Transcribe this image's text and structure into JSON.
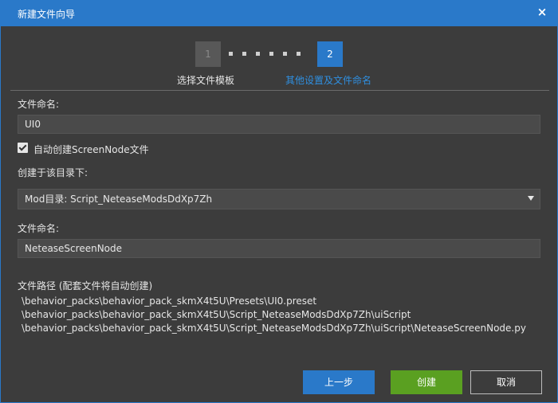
{
  "window": {
    "title": "新建文件向导",
    "close_icon": "×"
  },
  "steps": [
    {
      "number": "1",
      "label": "选择文件模板",
      "state": "done"
    },
    {
      "number": "2",
      "label": "其他设置及文件命名",
      "state": "active"
    }
  ],
  "form": {
    "filename_label": "文件命名:",
    "filename_value": "UI0",
    "auto_create_checked": true,
    "auto_create_label": "自动创建ScreenNode文件",
    "dir_label": "创建于该目录下:",
    "dir_value": "Mod目录: Script_NeteaseModsDdXp7Zh",
    "node_filename_label": "文件命名:",
    "node_filename_value": "NeteaseScreenNode"
  },
  "paths": {
    "label": "文件路径 (配套文件将自动创建)",
    "lines": [
      "\\behavior_packs\\behavior_pack_skmX4t5U\\Presets\\UI0.preset",
      "\\behavior_packs\\behavior_pack_skmX4t5U\\Script_NeteaseModsDdXp7Zh\\uiScript",
      "\\behavior_packs\\behavior_pack_skmX4t5U\\Script_NeteaseModsDdXp7Zh\\uiScript\\NeteaseScreenNode.py"
    ]
  },
  "buttons": {
    "prev": "上一步",
    "create": "创建",
    "cancel": "取消"
  },
  "colors": {
    "accent": "#2a79c9",
    "create": "#5aa021",
    "background": "#3c3c3c"
  }
}
